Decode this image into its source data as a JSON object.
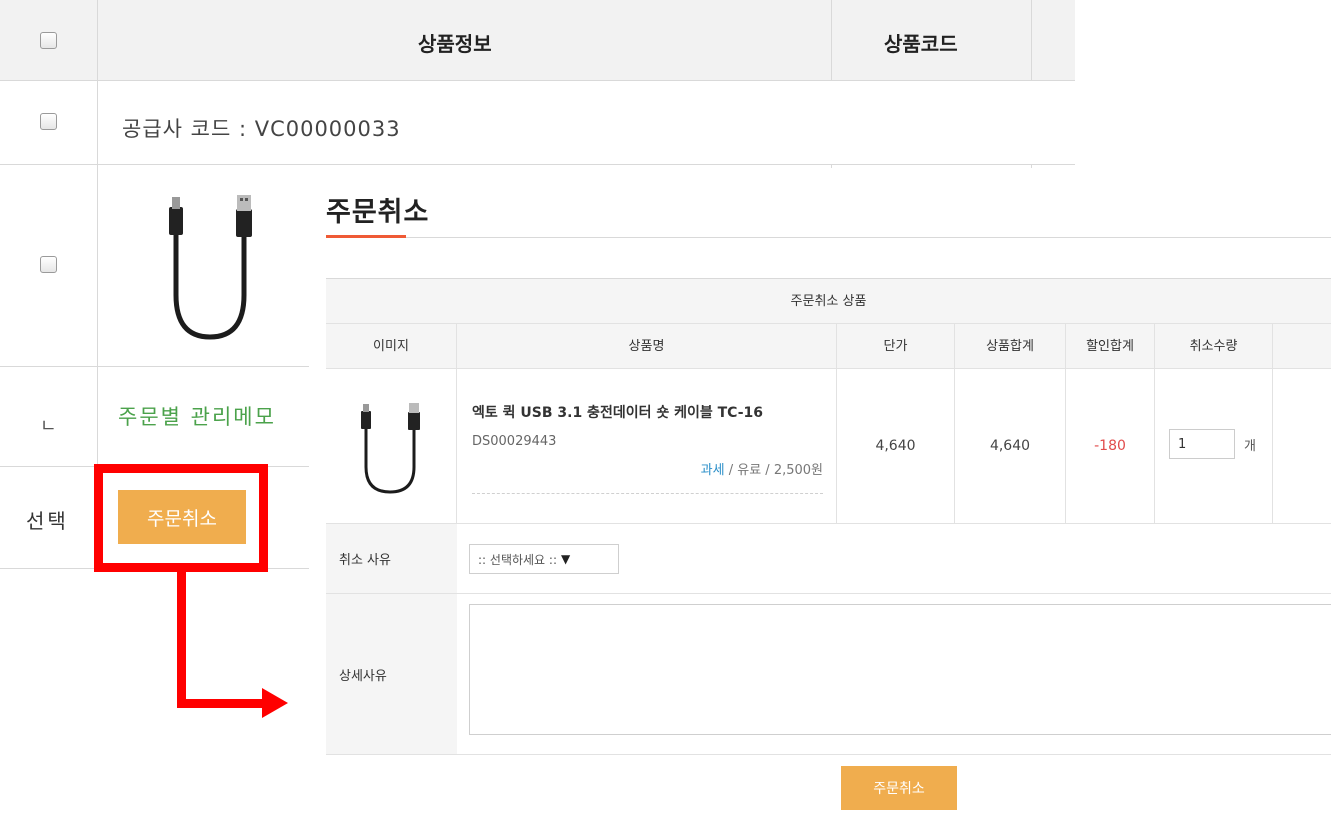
{
  "background_table": {
    "header": {
      "product_info": "상품정보",
      "product_code": "상품코드"
    },
    "supplier_row": "공급사 코드 : VC00000033",
    "memo_row": {
      "mark": "ㄴ",
      "label": "주문별 관리메모"
    },
    "footer": {
      "select_label": "선택",
      "cancel_button": "주문취소"
    }
  },
  "modal": {
    "title": "주문취소",
    "table": {
      "caption": "주문취소 상품",
      "columns": [
        "이미지",
        "상품명",
        "단가",
        "상품합계",
        "할인합계",
        "취소수량"
      ],
      "item": {
        "name": "엑토 퀵 USB 3.1 충전데이터 숏 케이블 TC-16",
        "code": "DS00029443",
        "tax": "과세",
        "shipping_type": "유료",
        "shipping_fee": "2,500원",
        "unit_price": "4,640",
        "total": "4,640",
        "discount": "-180",
        "cancel_qty": "1",
        "qty_unit": "개"
      }
    },
    "reason": {
      "label": "취소 사유",
      "select_value": ":: 선택하세요 ::"
    },
    "detail": {
      "label": "상세사유",
      "value": ""
    },
    "submit_button": "주문취소"
  },
  "colors": {
    "accent_orange": "#f0ad4e",
    "highlight_red": "#ff0000",
    "title_underline": "#ef5a35",
    "memo_green": "#4ba24b",
    "discount_red": "#e14b4b",
    "tax_link_blue": "#2a8fc9"
  }
}
